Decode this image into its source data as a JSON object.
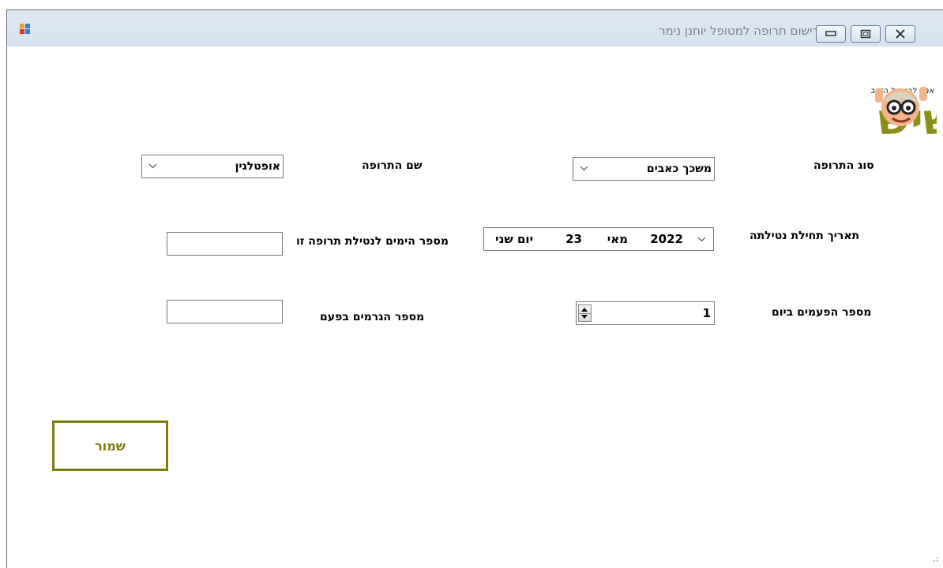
{
  "window": {
    "title": "רישום תרופה למטופל יוחנן נימר",
    "buttons": [
      "minimize-icon",
      "maximize-icon",
      "close-icon"
    ]
  },
  "logo": {
    "text": "הקשיש",
    "tagline": "דיור מוגן - בית אמון לבני גיל הזהב",
    "color": "#8a8f1a"
  },
  "form": {
    "medication_type": {
      "label": "סוג התרופה",
      "value": "משכך כאבים"
    },
    "medication_name": {
      "label": "שם התרופה",
      "value": "אופטלגין"
    },
    "start_date": {
      "label": "תאריך תחילת נטילתה",
      "day_name": "יום שני",
      "day": "23",
      "month": "מאי",
      "year": "2022"
    },
    "days_count": {
      "label": "מספר הימים לנטילת תרופה זו",
      "value": ""
    },
    "times_per_day": {
      "label": "מספר הפעמים ביום",
      "value": "1"
    },
    "doses_per_time": {
      "label": "מספר הגרמים בפעם",
      "value": ""
    }
  },
  "actions": {
    "save_label": "שמור"
  },
  "colors": {
    "accent": "#7f7a0b",
    "titlebar": "#dbe6f4"
  }
}
